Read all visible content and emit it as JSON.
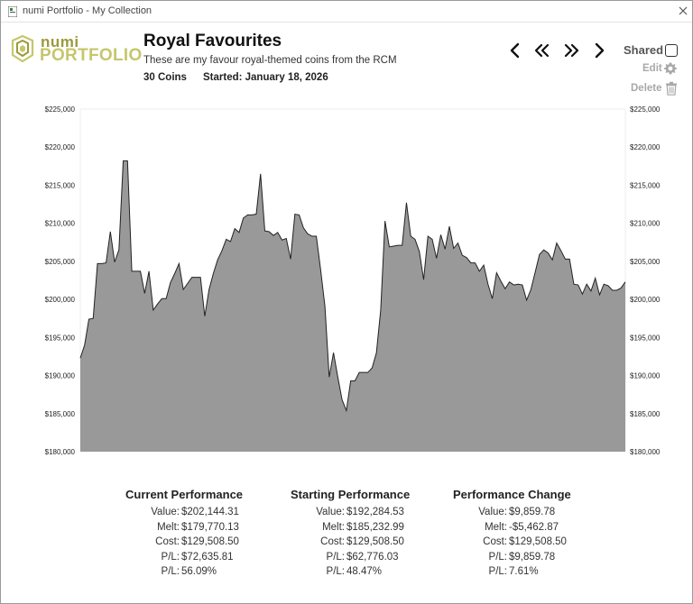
{
  "window": {
    "title": "numi Portfolio - My Collection"
  },
  "logo": {
    "line1": "numi",
    "line2": "PORTFOLIO",
    "colors": {
      "primary": "#9b9a3a",
      "secondary": "#c6c66c"
    }
  },
  "collection": {
    "title": "Royal Favourites",
    "description": "These are my favour royal-themed coins from the RCM",
    "coins": "30 Coins",
    "started": "Started: January 18, 2026"
  },
  "controls": {
    "nav_icons": [
      "chevron-left-icon",
      "double-chevron-left-icon",
      "double-chevron-right-icon",
      "chevron-right-icon"
    ],
    "shared_label": "Shared",
    "shared_checked": false,
    "edit_label": "Edit",
    "delete_label": "Delete"
  },
  "chart_data": {
    "type": "area",
    "title": "",
    "ylim": [
      180000,
      225000
    ],
    "y_ticks": [
      "$180,000",
      "$185,000",
      "$190,000",
      "$195,000",
      "$200,000",
      "$205,000",
      "$210,000",
      "$215,000",
      "$220,000",
      "$225,000"
    ],
    "y_tick_values": [
      180000,
      185000,
      190000,
      195000,
      200000,
      205000,
      210000,
      215000,
      220000,
      225000
    ],
    "fill_color": "#999999",
    "line_color": "#222222",
    "grid": false,
    "values": [
      192300,
      194000,
      197400,
      197500,
      204700,
      204700,
      204800,
      208900,
      204900,
      206500,
      218200,
      218200,
      203700,
      203700,
      203700,
      200800,
      203700,
      198600,
      199400,
      200100,
      200100,
      202200,
      203400,
      204700,
      201300,
      202100,
      202900,
      202900,
      202900,
      197800,
      201300,
      203400,
      205200,
      206400,
      207900,
      207600,
      209300,
      208800,
      210700,
      211100,
      211100,
      211200,
      216500,
      209000,
      208900,
      208400,
      208800,
      207800,
      208000,
      205300,
      211200,
      211100,
      209400,
      208600,
      208300,
      208300,
      203900,
      199100,
      189800,
      193000,
      189800,
      186800,
      185400,
      189300,
      189300,
      190400,
      190400,
      190400,
      191000,
      193000,
      198600,
      210300,
      206900,
      207000,
      207100,
      207100,
      212700,
      208300,
      207900,
      206300,
      202600,
      208300,
      207900,
      205400,
      208500,
      206600,
      209600,
      206700,
      207400,
      205800,
      205500,
      204800,
      204800,
      203700,
      204500,
      202000,
      200100,
      203500,
      202400,
      201400,
      202300,
      201900,
      202000,
      201900,
      199900,
      201300,
      203600,
      205900,
      206500,
      206100,
      205200,
      207400,
      206400,
      205300,
      205300,
      202000,
      201900,
      200700,
      202000,
      201100,
      202800,
      200600,
      202000,
      201800,
      201200,
      201200,
      201500,
      202300
    ]
  },
  "performance": [
    {
      "heading": "Current Performance",
      "rows": [
        {
          "label": "Value:",
          "value": "$202,144.31"
        },
        {
          "label": "Melt:",
          "value": "$179,770.13"
        },
        {
          "label": "Cost:",
          "value": "$129,508.50"
        },
        {
          "label": "P/L:",
          "value": "$72,635.81"
        },
        {
          "label": "P/L:",
          "value": "56.09%"
        }
      ]
    },
    {
      "heading": "Starting Performance",
      "rows": [
        {
          "label": "Value:",
          "value": "$192,284.53"
        },
        {
          "label": "Melt:",
          "value": "$185,232.99"
        },
        {
          "label": "Cost:",
          "value": "$129,508.50"
        },
        {
          "label": "P/L:",
          "value": "$62,776.03"
        },
        {
          "label": "P/L:",
          "value": "48.47%"
        }
      ]
    },
    {
      "heading": "Performance Change",
      "rows": [
        {
          "label": "Value:",
          "value": "$9,859.78"
        },
        {
          "label": "Melt:",
          "value": "-$5,462.87"
        },
        {
          "label": "Cost:",
          "value": "$129,508.50"
        },
        {
          "label": "P/L:",
          "value": "$9,859.78"
        },
        {
          "label": "P/L:",
          "value": "7.61%"
        }
      ]
    }
  ]
}
